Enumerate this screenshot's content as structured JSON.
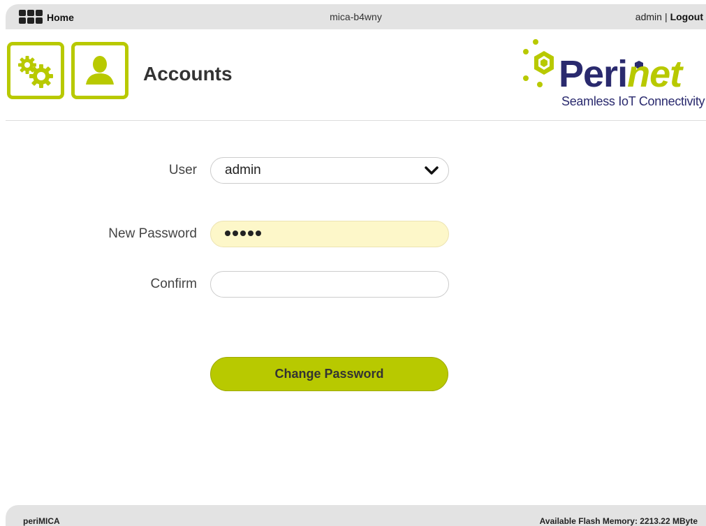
{
  "topbar": {
    "home_label": "Home",
    "hostname": "mica-b4wny",
    "username": "admin",
    "separator": "|",
    "logout_label": "Logout"
  },
  "header": {
    "title": "Accounts",
    "logo_name": "Perinet",
    "logo_tagline": "Seamless IoT Connectivity"
  },
  "form": {
    "user_label": "User",
    "user_value": "admin",
    "new_password_label": "New Password",
    "new_password_masked_length": 5,
    "confirm_label": "Confirm",
    "confirm_value": "",
    "submit_label": "Change Password"
  },
  "footer": {
    "product": "periMICA",
    "flash_memory": "Available Flash Memory: 2213.22 MByte"
  },
  "colors": {
    "accent": "#b8c900",
    "brand_dark": "#2a2a6e",
    "autofill": "#fdf7c9",
    "bar_bg": "#e3e3e3"
  },
  "icons": [
    "apps-grid-icon",
    "gears-icon",
    "user-icon",
    "chevron-down-icon",
    "perinet-logo"
  ]
}
